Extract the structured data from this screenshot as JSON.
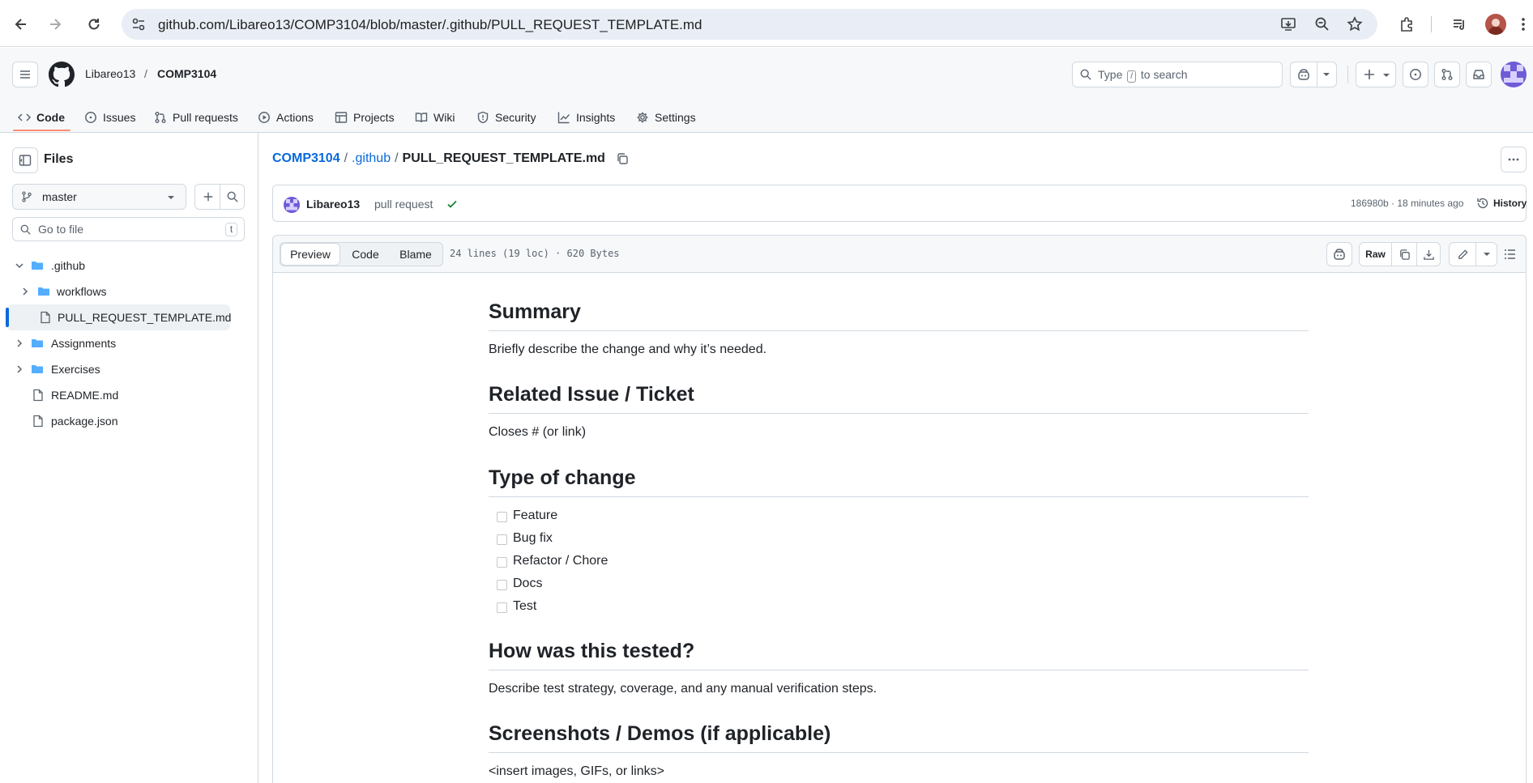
{
  "browser": {
    "url": "github.com/Libareo13/COMP3104/blob/master/.github/PULL_REQUEST_TEMPLATE.md"
  },
  "header": {
    "owner": "Libareo13",
    "separator": "/",
    "repo": "COMP3104",
    "search_prefix": "Type",
    "search_key": "/",
    "search_suffix": "to search"
  },
  "tabs": [
    {
      "label": "Code",
      "icon": "code-icon"
    },
    {
      "label": "Issues",
      "icon": "issue-icon"
    },
    {
      "label": "Pull requests",
      "icon": "pull-request-icon"
    },
    {
      "label": "Actions",
      "icon": "play-icon"
    },
    {
      "label": "Projects",
      "icon": "table-icon"
    },
    {
      "label": "Wiki",
      "icon": "book-icon"
    },
    {
      "label": "Security",
      "icon": "shield-icon"
    },
    {
      "label": "Insights",
      "icon": "graph-icon"
    },
    {
      "label": "Settings",
      "icon": "gear-icon"
    }
  ],
  "sidebar": {
    "title": "Files",
    "branch": "master",
    "goto_placeholder": "Go to file",
    "goto_shortcut": "t",
    "tree": [
      {
        "label": ".github",
        "type": "folder",
        "expanded": true
      },
      {
        "label": "workflows",
        "type": "folder",
        "expanded": false
      },
      {
        "label": "PULL_REQUEST_TEMPLATE.md",
        "type": "file",
        "selected": true
      },
      {
        "label": "Assignments",
        "type": "folder",
        "expanded": false
      },
      {
        "label": "Exercises",
        "type": "folder",
        "expanded": false
      },
      {
        "label": "README.md",
        "type": "file"
      },
      {
        "label": "package.json",
        "type": "file"
      }
    ]
  },
  "breadcrumb": {
    "repo": "COMP3104",
    "sep1": "/",
    "folder": ".github",
    "sep2": "/",
    "file": "PULL_REQUEST_TEMPLATE.md"
  },
  "commit": {
    "author": "Libareo13",
    "message": "pull request",
    "sha_time": "186980b · 18 minutes ago",
    "history": "History"
  },
  "file_header": {
    "views": [
      "Preview",
      "Code",
      "Blame"
    ],
    "info": "24 lines (19 loc) · 620 Bytes",
    "raw": "Raw"
  },
  "markdown": {
    "h_summary": "Summary",
    "p_summary": "Briefly describe the change and why it’s needed.",
    "h_related": "Related Issue / Ticket",
    "p_related": "Closes # (or link)",
    "h_type": "Type of change",
    "checklist": [
      "Feature",
      "Bug fix",
      "Refactor / Chore",
      "Docs",
      "Test"
    ],
    "h_tested": "How was this tested?",
    "p_tested": "Describe test strategy, coverage, and any manual verification steps.",
    "h_screens": "Screenshots / Demos (if applicable)",
    "p_screens": "<insert images, GIFs, or links>"
  },
  "colors": {
    "link": "#0969da",
    "tab_underline": "#fd8c73",
    "success": "#1a7f37",
    "selected_bar": "#0969da"
  }
}
